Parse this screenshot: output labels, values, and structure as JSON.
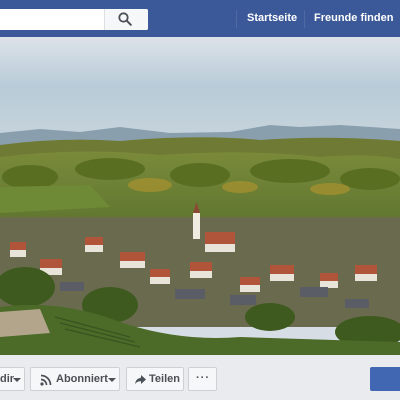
{
  "header": {
    "search": {
      "value": "",
      "placeholder": ""
    },
    "nav": [
      {
        "label": "Startseite"
      },
      {
        "label": "Freunde finden"
      }
    ]
  },
  "cover": {
    "description_icon": "landscape-photo"
  },
  "actions": {
    "like_label": "dir",
    "follow_label": "Abonniert",
    "share_label": "Teilen",
    "more_label": "···"
  },
  "colors": {
    "brand": "#3b5998",
    "button_blue": "#4267b2"
  }
}
